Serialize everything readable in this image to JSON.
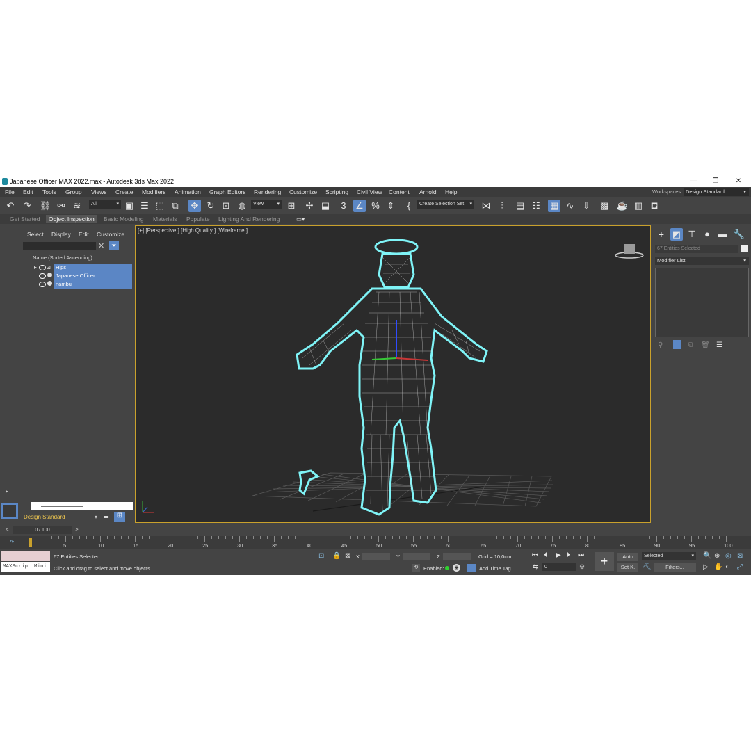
{
  "window": {
    "title": "Japanese Officer MAX 2022.max - Autodesk 3ds Max 2022",
    "minimize": "—",
    "restore": "❐",
    "close": "✕"
  },
  "menu": [
    "File",
    "Edit",
    "Tools",
    "Group",
    "Views",
    "Create",
    "Modifiers",
    "Animation",
    "Graph Editors",
    "Rendering",
    "Customize",
    "Scripting",
    "Civil View",
    "Content",
    "Arnold",
    "Help"
  ],
  "workspaces": {
    "label": "Workspaces:",
    "value": "Design Standard"
  },
  "toolbar": {
    "filter": "All",
    "view": "View",
    "selection_set": "Create Selection Set"
  },
  "ribbon": [
    "Get Started",
    "Object Inspection",
    "Basic Modeling",
    "Materials",
    "Populate",
    "Lighting And Rendering"
  ],
  "scene_explorer": {
    "tabs": [
      "Select",
      "Display",
      "Edit",
      "Customize"
    ],
    "header": "Name (Sorted Ascending)",
    "items": [
      "Hips",
      "Japanese Officer",
      "nambu"
    ],
    "workspace": "Design Standard"
  },
  "viewport": {
    "label": "[+] [Perspective ] [High Quality ] [Wireframe ]"
  },
  "command_panel": {
    "entities": "67 Entities Selected",
    "modifier_list": "Modifier List"
  },
  "timeline": {
    "frame": "0 / 100",
    "ticks": [
      "0",
      "5",
      "10",
      "15",
      "20",
      "25",
      "30",
      "35",
      "40",
      "45",
      "50",
      "55",
      "60",
      "65",
      "70",
      "75",
      "80",
      "85",
      "90",
      "95",
      "100"
    ]
  },
  "status": {
    "maxscript": "MAXScript Mini",
    "selected": "67 Entities Selected",
    "prompt": "Click and drag to select and move objects",
    "x": "X:",
    "y": "Y:",
    "z": "Z:",
    "grid": "Grid = 10,0cm",
    "enabled": "Enabled:",
    "add_time_tag": "Add Time Tag",
    "auto": "Auto",
    "set_key": "Set K.",
    "selected_drop": "Selected",
    "filters": "Filters...",
    "frame_field": "0"
  }
}
